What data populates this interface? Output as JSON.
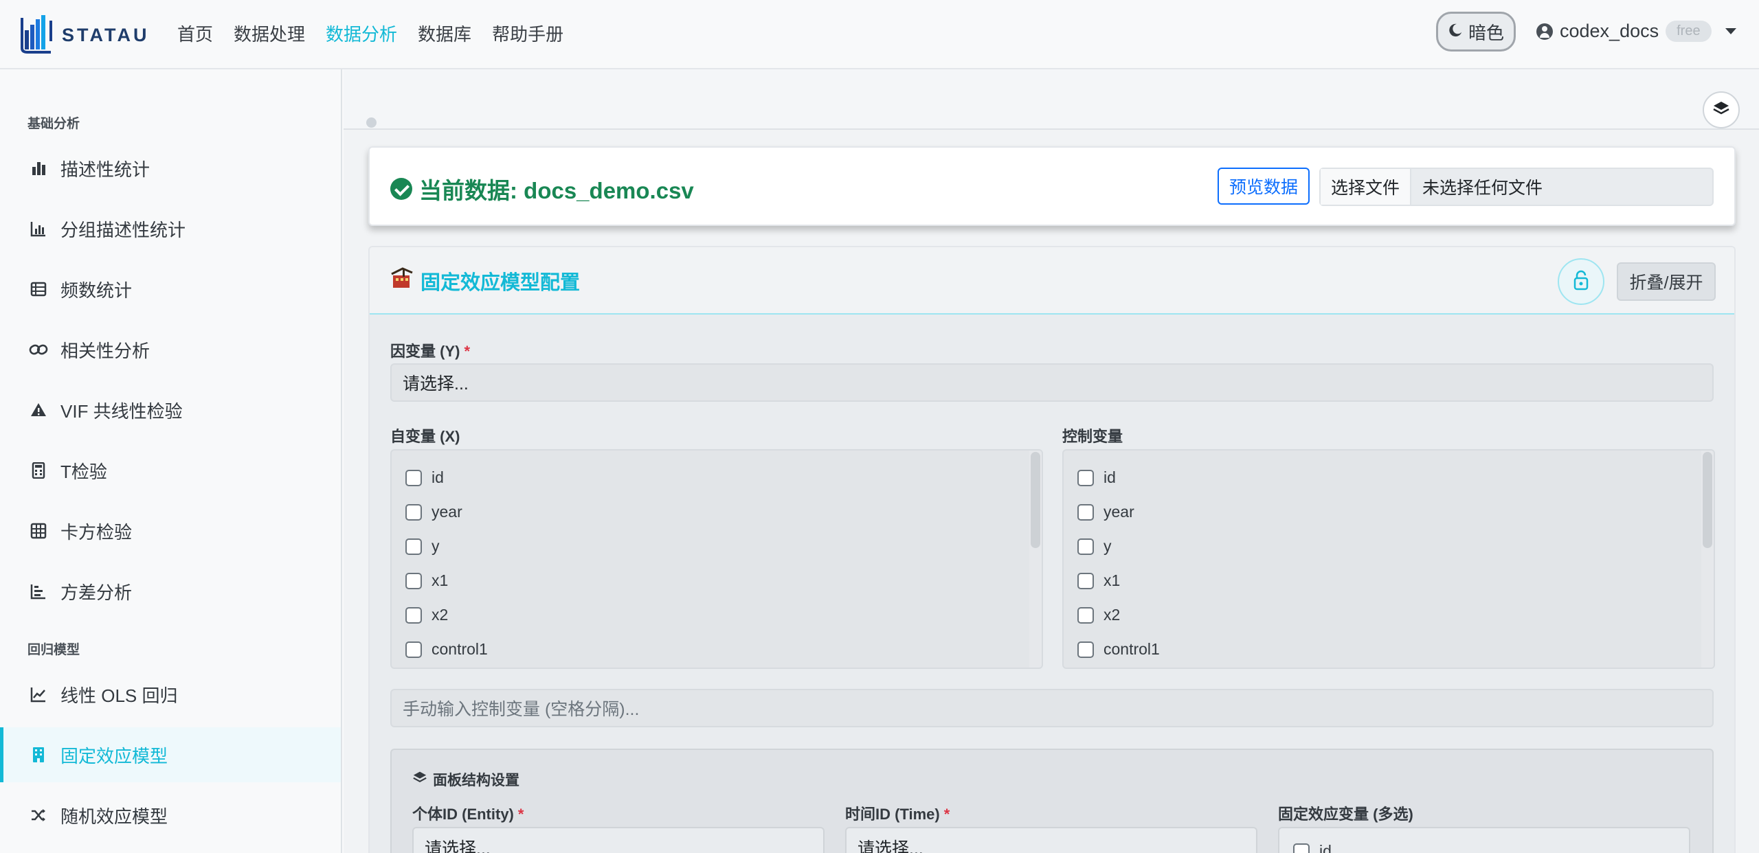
{
  "brand": {
    "name": "STATAU"
  },
  "nav": {
    "links": [
      "首页",
      "数据处理",
      "数据分析",
      "数据库",
      "帮助手册"
    ],
    "active_index": 2
  },
  "theme_toggle": {
    "label": "暗色"
  },
  "user": {
    "name": "codex_docs",
    "plan": "free"
  },
  "sidebar": {
    "section_basic": "基础分析",
    "basic_items": [
      {
        "label": "描述性统计",
        "icon": "bar-chart-icon"
      },
      {
        "label": "分组描述性统计",
        "icon": "bar-chart-line-icon"
      },
      {
        "label": "频数统计",
        "icon": "table-list-icon"
      },
      {
        "label": "相关性分析",
        "icon": "link-icon"
      },
      {
        "label": "VIF 共线性检验",
        "icon": "warning-icon"
      },
      {
        "label": "T检验",
        "icon": "calculator-icon"
      },
      {
        "label": "卡方检验",
        "icon": "grid-icon"
      },
      {
        "label": "方差分析",
        "icon": "bar-chart-steps-icon"
      }
    ],
    "section_regression": "回归模型",
    "regression_items": [
      {
        "label": "线性 OLS 回归",
        "icon": "line-chart-icon"
      },
      {
        "label": "固定效应模型",
        "icon": "building-icon"
      },
      {
        "label": "随机效应模型",
        "icon": "shuffle-icon"
      }
    ],
    "active_label": "固定效应模型"
  },
  "file_card": {
    "title": "当前数据: docs_demo.csv",
    "preview_label": "预览数据",
    "choose_file_label": "选择文件",
    "file_status": "未选择任何文件"
  },
  "config": {
    "title": "固定效应模型配置",
    "collapse_label": "折叠/展开",
    "dep_var_label": "因变量 (Y)",
    "dep_var_placeholder": "请选择...",
    "indep_label": "自变量 (X)",
    "control_label": "控制变量",
    "variables": [
      "id",
      "year",
      "y",
      "x1",
      "x2",
      "control1"
    ],
    "manual_placeholder": "手动输入控制变量 (空格分隔)...",
    "panel": {
      "title": "面板结构设置",
      "entity_label": "个体ID (Entity)",
      "entity_placeholder": "请选择...",
      "time_label": "时间ID (Time)",
      "time_placeholder": "请选择...",
      "fe_label": "固定效应变量 (多选)",
      "fe_first_option": "id"
    }
  },
  "colors": {
    "accent": "#13b9d6",
    "success": "#198754",
    "primary": "#0d6efd",
    "required": "#dc3545"
  }
}
